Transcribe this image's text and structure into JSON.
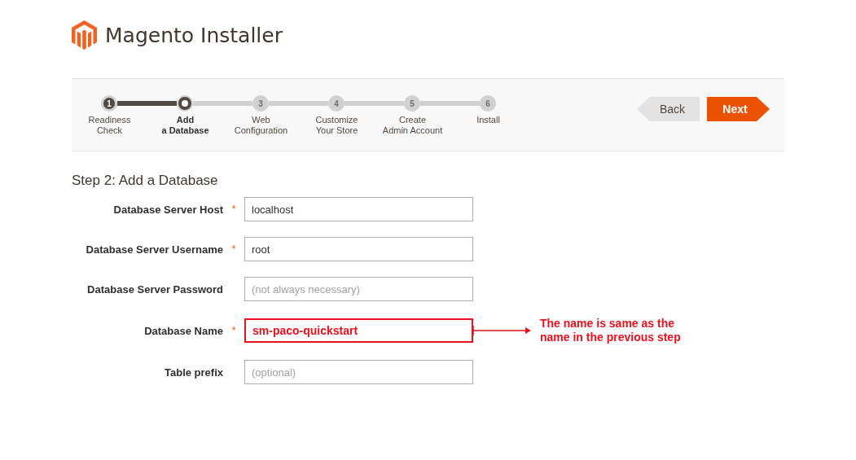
{
  "header": {
    "title": "Magento Installer"
  },
  "steps": [
    {
      "number": "1",
      "label": "Readiness\nCheck",
      "done": true,
      "current": false
    },
    {
      "label": "Add\na Database",
      "done": false,
      "current": true
    },
    {
      "number": "3",
      "label": "Web\nConfiguration",
      "done": false,
      "current": false
    },
    {
      "number": "4",
      "label": "Customize\nYour Store",
      "done": false,
      "current": false
    },
    {
      "number": "5",
      "label": "Create\nAdmin Account",
      "done": false,
      "current": false
    },
    {
      "number": "6",
      "label": "Install",
      "done": false,
      "current": false
    }
  ],
  "nav_buttons": [
    {
      "label": "Back",
      "kind": "back"
    },
    {
      "label": "Next",
      "kind": "next"
    }
  ],
  "heading": "Step 2: Add a Database",
  "fields": [
    {
      "label": "Database Server Host",
      "required": true,
      "value": "localhost",
      "highlighted": false
    },
    {
      "label": "Database Server Username",
      "required": true,
      "value": "root",
      "highlighted": false
    },
    {
      "label": "Database Server Password",
      "required": false,
      "placeholder": "(not always necessary)",
      "highlighted": false
    },
    {
      "label": "Database Name",
      "required": true,
      "value": "sm-paco-quickstart",
      "highlighted": true
    },
    {
      "label": "Table prefix",
      "required": false,
      "placeholder": "(optional)",
      "highlighted": false
    }
  ],
  "required_mark": "*",
  "annotation": {
    "text": "The name is same as the name in the previous step"
  }
}
